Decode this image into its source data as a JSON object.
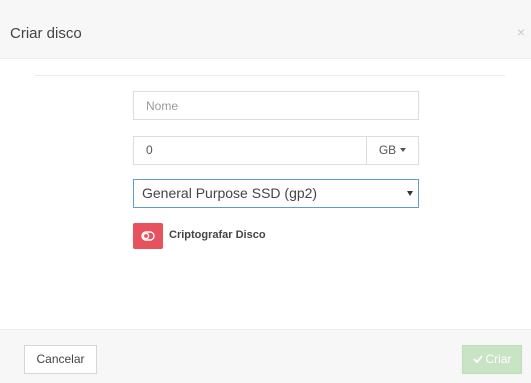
{
  "modal": {
    "title": "Criar disco",
    "close_icon": "×"
  },
  "form": {
    "name": {
      "placeholder": "Nome",
      "value": ""
    },
    "size": {
      "value": "0",
      "unit": "GB"
    },
    "volume_type": {
      "selected": "General Purpose SSD (gp2)"
    },
    "encrypt": {
      "label": "Criptografar Disco",
      "enabled": false,
      "toggle_color": "#e8525f"
    }
  },
  "footer": {
    "cancel_label": "Cancelar",
    "create_label": "Criar",
    "create_disabled": true
  },
  "icons": {
    "close": "close-icon",
    "unit_caret": "caret-down-icon",
    "select_caret": "caret-down-icon",
    "toggle": "toggle-off-icon",
    "check": "check-icon"
  }
}
